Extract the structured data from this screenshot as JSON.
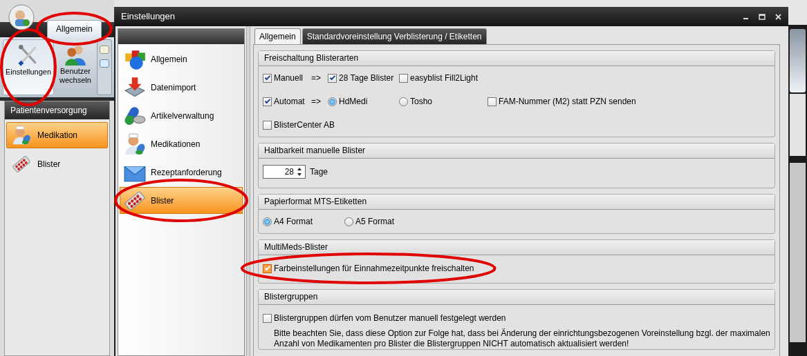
{
  "app": {
    "ribbon_tabs": [
      {
        "label": "Allgemein",
        "selected": true,
        "circled": true
      }
    ],
    "ribbon_buttons": [
      {
        "label": "Einstellungen",
        "selected": true,
        "circled": true
      },
      {
        "label": "Benutzer wechseln",
        "selected": false,
        "circled": false
      }
    ],
    "sidebar": {
      "title": "Patientenversorgung",
      "items": [
        {
          "label": "Medikation",
          "selected": true
        },
        {
          "label": "Blister",
          "selected": false
        }
      ]
    }
  },
  "dialog": {
    "title": "Einstellungen",
    "nav": [
      {
        "label": "Allgemein",
        "selected": false,
        "circled": false
      },
      {
        "label": "Datenimport",
        "selected": false,
        "circled": false
      },
      {
        "label": "Artikelverwaltung",
        "selected": false,
        "circled": false
      },
      {
        "label": "Medikationen",
        "selected": false,
        "circled": false
      },
      {
        "label": "Rezeptanforderung",
        "selected": false,
        "circled": false
      },
      {
        "label": "Blister",
        "selected": true,
        "circled": true
      }
    ],
    "tabs": [
      {
        "label": "Allgemein",
        "selected": true
      },
      {
        "label": "Standardvoreinstellung Verblisterung / Etiketten",
        "selected": false
      }
    ],
    "groups": [
      {
        "title": "Freischaltung Blisterarten",
        "rows": [
          [
            {
              "kind": "check",
              "label": "Manuell",
              "checked": true
            },
            {
              "kind": "text",
              "label": "=>"
            },
            {
              "kind": "check",
              "label": "28 Tage Blister",
              "checked": true
            },
            {
              "kind": "check",
              "label": "easyblist Fill2Light",
              "checked": false
            }
          ],
          [
            {
              "kind": "check",
              "label": "Automat",
              "checked": true
            },
            {
              "kind": "text",
              "label": "=>"
            },
            {
              "kind": "radio",
              "label": "HdMedi",
              "selected": true
            },
            {
              "kind": "radio",
              "label": "Tosho",
              "selected": false
            },
            {
              "kind": "check",
              "label": "FAM-Nummer (M2) statt PZN senden",
              "checked": false
            }
          ],
          [
            {
              "kind": "check",
              "label": "BlisterCenter AB",
              "checked": false
            }
          ]
        ]
      },
      {
        "title": "Haltbarkeit manuelle Blister",
        "rows": [
          [
            {
              "kind": "spin",
              "value": "28"
            },
            {
              "kind": "text",
              "label": "Tage"
            }
          ]
        ]
      },
      {
        "title": "Papierformat MTS-Etiketten",
        "rows": [
          [
            {
              "kind": "radio",
              "label": "A4 Format",
              "selected": true
            },
            {
              "kind": "radio",
              "label": "A5 Format",
              "selected": false
            }
          ]
        ]
      },
      {
        "title": "MultiMeds-Blister",
        "rows": [
          [
            {
              "kind": "check",
              "label": "Farbeinstellungen für Einnahmezeitpunkte freischalten",
              "checked": true,
              "circled": true
            }
          ]
        ]
      },
      {
        "title": "Blistergruppen",
        "rows": [
          [
            {
              "kind": "check",
              "label": "Blistergruppen dürfen vom Benutzer manuell festgelegt werden",
              "checked": false
            }
          ],
          [
            {
              "kind": "note",
              "label": "Bitte beachten Sie, dass diese Option zur Folge hat, dass bei Änderung der einrichtungsbezogenen Voreinstellung bzgl. der maximalen Anzahl von Medikamenten pro Blister die Blistergruppen NICHT automatisch aktualisiert werden!"
            }
          ]
        ]
      }
    ]
  }
}
